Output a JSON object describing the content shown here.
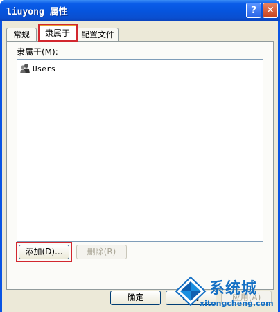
{
  "window": {
    "title": "liuyong 属性",
    "help_label": "?",
    "close_label": "✕"
  },
  "tabs": [
    {
      "label": "常规",
      "active": false
    },
    {
      "label": "隶属于",
      "active": true
    },
    {
      "label": "配置文件",
      "active": false
    }
  ],
  "member_of": {
    "label": "隶属于(M):",
    "items": [
      {
        "name": "Users",
        "icon": "users-group-icon"
      }
    ],
    "add_label": "添加(D)...",
    "remove_label": "删除(R)"
  },
  "footer": {
    "ok_label": "确定",
    "cancel_label": "取消",
    "apply_label": "应用(A)"
  },
  "watermark": {
    "name": "系统城",
    "url": "xitongcheng.com"
  },
  "colors": {
    "title_bar": "#0a54e4",
    "highlight": "#d2272f",
    "watermark": "#1570c4"
  }
}
